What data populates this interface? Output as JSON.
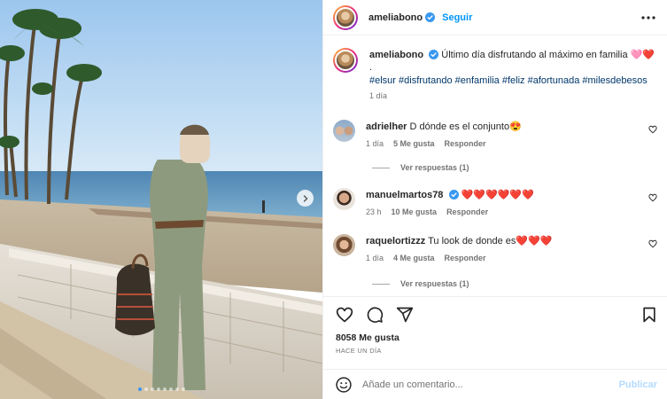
{
  "post": {
    "username": "ameliabono",
    "follow_label": "Seguir",
    "caption": "Último día disfrutando al máximo en familia 🩷❤️",
    "caption_dot": ".",
    "hashtags": [
      "#elsur",
      "#disfrutando",
      "#enfamilia",
      "#feliz",
      "#afortunada",
      "#milesdebesos"
    ],
    "age": "1 día"
  },
  "comments": [
    {
      "username": "adrielher",
      "text": "D dónde es el conjunto😍",
      "age": "1 día",
      "likes": "5 Me gusta",
      "reply_label": "Responder",
      "view_replies": "Ver respuestas (1)",
      "verified": false
    },
    {
      "username": "manuelmartos78",
      "text": "❤️❤️❤️❤️❤️❤️",
      "age": "23 h",
      "likes": "10 Me gusta",
      "reply_label": "Responder",
      "verified": true
    },
    {
      "username": "raquelortizzz",
      "text": "Tu look de donde es❤️❤️❤️",
      "age": "1 día",
      "likes": "4 Me gusta",
      "reply_label": "Responder",
      "view_replies": "Ver respuestas (1)",
      "verified": false
    }
  ],
  "actions": {
    "likes_count": "8058 Me gusta",
    "timestamp": "HACE UN DÍA"
  },
  "add_comment": {
    "placeholder": "Añade un comentario...",
    "publish_label": "Publicar"
  },
  "carousel": {
    "slide_count": 8,
    "active_index": 0
  },
  "colors": {
    "accent": "#0095f6",
    "verified": "#3897f0",
    "hashtag": "#00376b",
    "muted": "#737373"
  },
  "icons": [
    "more-icon",
    "heart-icon",
    "comment-icon",
    "share-icon",
    "bookmark-icon",
    "emoji-icon",
    "verified-icon",
    "chevron-right-icon"
  ]
}
